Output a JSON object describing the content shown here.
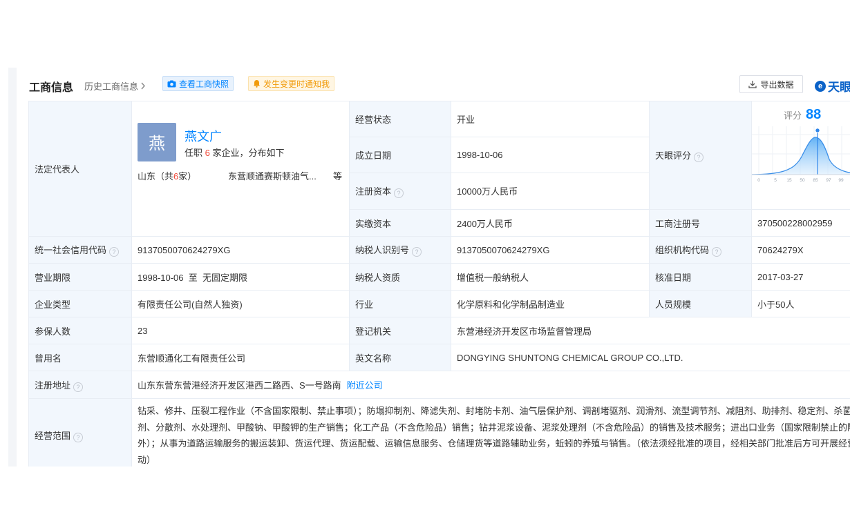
{
  "header": {
    "title": "工商信息",
    "history_link": "历史工商信息",
    "snapshot_button": "查看工商快照",
    "notify_button": "发生变更时通知我",
    "export_button": "导出数据",
    "brand": "天眼"
  },
  "legal_rep": {
    "label": "法定代表人",
    "avatar_char": "燕",
    "name": "燕文广",
    "desc_prefix": "任职",
    "company_count": "6",
    "desc_suffix": "家企业，分布如下",
    "province_prefix": "山东（共",
    "province_count": "6",
    "province_suffix": "家）",
    "company_preview": "东营顺通赛斯顿油气...",
    "more": "等"
  },
  "status": {
    "label": "经营状态",
    "value": "开业"
  },
  "founded": {
    "label": "成立日期",
    "value": "1998-10-06"
  },
  "registered_capital": {
    "label": "注册资本",
    "value": "10000万人民币"
  },
  "paid_capital": {
    "label": "实缴资本",
    "value": "2400万人民币"
  },
  "tianyan_score": {
    "label": "天眼评分",
    "score_label": "评分",
    "score": 88,
    "axis_ticks": [
      "0",
      "5",
      "15",
      "50",
      "85",
      "97",
      "99"
    ]
  },
  "reg_number": {
    "label": "工商注册号",
    "value": "370500228002959"
  },
  "credit_code": {
    "label": "统一社会信用代码",
    "value": "9137050070624279XG"
  },
  "taxpayer_id": {
    "label": "纳税人识别号",
    "value": "9137050070624279XG"
  },
  "org_code": {
    "label": "组织机构代码",
    "value": "70624279X"
  },
  "term": {
    "label": "营业期限",
    "value": "1998-10-06  至  无固定期限"
  },
  "taxpayer_type": {
    "label": "纳税人资质",
    "value": "增值税一般纳税人"
  },
  "approval_date": {
    "label": "核准日期",
    "value": "2017-03-27"
  },
  "company_type": {
    "label": "企业类型",
    "value": "有限责任公司(自然人独资)"
  },
  "industry": {
    "label": "行业",
    "value": "化学原料和化学制品制造业"
  },
  "staff_size": {
    "label": "人员规模",
    "value": "小于50人"
  },
  "insured": {
    "label": "参保人数",
    "value": "23"
  },
  "reg_authority": {
    "label": "登记机关",
    "value": "东营港经济开发区市场监督管理局"
  },
  "former_name": {
    "label": "曾用名",
    "value": "东营顺通化工有限责任公司"
  },
  "english_name": {
    "label": "英文名称",
    "value": "DONGYING SHUNTONG CHEMICAL GROUP CO.,LTD."
  },
  "address": {
    "label": "注册地址",
    "value": "山东东营东营港经济开发区港西二路西、S一号路南",
    "link": "附近公司"
  },
  "scope": {
    "label": "经营范围",
    "value": "钻采、修井、压裂工程作业（不含国家限制、禁止事项）；防塌抑制剂、降滤失剂、封堵防卡剂、油气层保护剂、调剖堵驱剂、润滑剂、流型调节剂、减阻剂、助排剂、稳定剂、杀菌剂、分散剂、水处理剂、甲酸钠、甲酸钾的生产销售；化工产品（不含危险品）销售；钻井泥浆设备、泥浆处理剂（不含危险品）的销售及技术服务；进出口业务（国家限制禁止的除外）；从事为道路运输服务的搬运装卸、货运代理、货运配载、运输信息服务、仓储理货等道路辅助业务，蚯蚓的养殖与销售。（依法须经批准的项目，经相关部门批准后方可开展经营活动）"
  }
}
